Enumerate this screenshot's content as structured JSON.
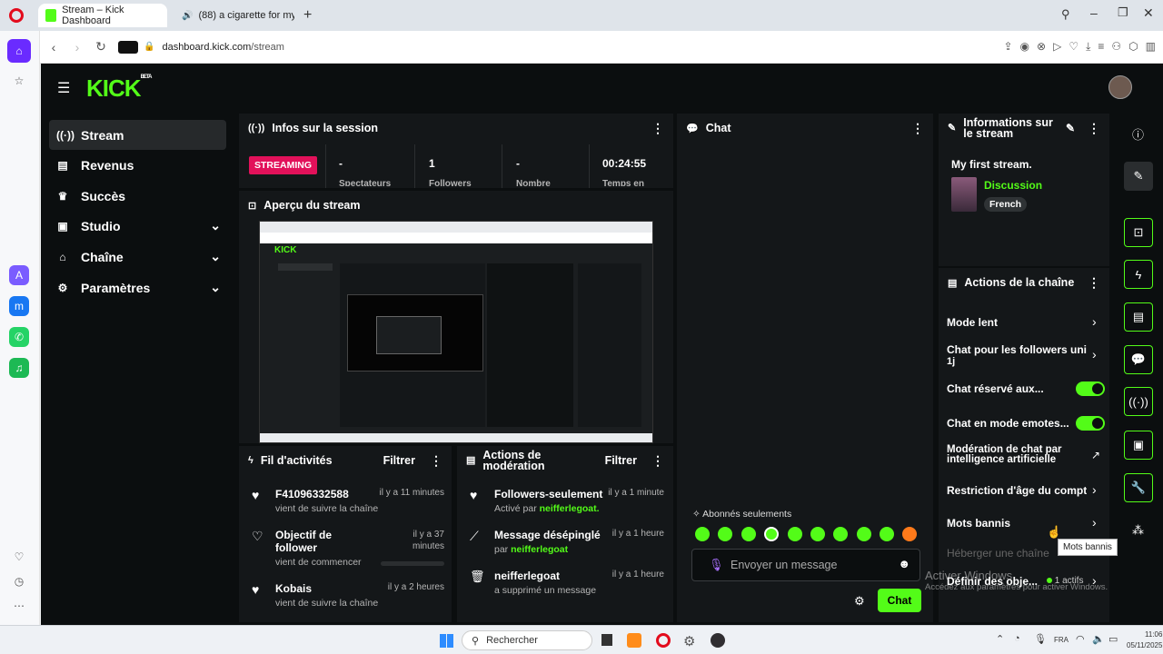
{
  "browser": {
    "tabs": [
      {
        "title": "Stream – Kick Dashboard"
      },
      {
        "title": "(88) a cigarette for my"
      }
    ],
    "url_domain": "dashboard.kick.com",
    "url_path": "/stream"
  },
  "app": {
    "logo_text": "KICK",
    "logo_badge": "BETA",
    "sidebar": [
      {
        "label": "Stream",
        "active": true
      },
      {
        "label": "Revenus"
      },
      {
        "label": "Succès"
      },
      {
        "label": "Studio",
        "expandable": true
      },
      {
        "label": "Chaîne",
        "expandable": true
      },
      {
        "label": "Paramètres",
        "expandable": true
      }
    ],
    "session": {
      "title": "Infos sur la session",
      "status": "STREAMING",
      "stats": [
        {
          "value": "-",
          "label": "Spectateurs"
        },
        {
          "value": "1",
          "label": "Followers"
        },
        {
          "value": "-",
          "label": "Nombre"
        },
        {
          "value": "00:24:55",
          "label": "Temps en"
        }
      ]
    },
    "preview": {
      "title": "Aperçu du stream"
    },
    "activity": {
      "title": "Fil d'activités",
      "filter_label": "Filtrer",
      "items": [
        {
          "name": "F41096332588",
          "time": "il y a 11 minutes",
          "desc": "vient de suivre la chaîne"
        },
        {
          "name": "Objectif de follower",
          "time": "il y a 37 minutes",
          "desc": "vient de commencer"
        },
        {
          "name": "Kobais",
          "time": "il y a 2 heures",
          "desc": "vient de suivre la chaîne"
        }
      ]
    },
    "moderation": {
      "title": "Actions de modération",
      "filter_label": "Filtrer",
      "items": [
        {
          "name": "Followers-seulement",
          "time": "il y a 1 minute",
          "desc_prefix": "Activé par",
          "actor": "neifferlegoat."
        },
        {
          "name": "Message désépinglé",
          "time": "il y a 1 heure",
          "desc_prefix": "par",
          "actor": "neifferlegoat"
        },
        {
          "name": "neifferlegoat",
          "time": "il y a 1 heure",
          "desc_prefix": "a supprimé un message",
          "actor": ""
        }
      ]
    },
    "chat": {
      "title": "Chat",
      "mode_label": "Abonnés seulements",
      "input_placeholder": "Envoyer un message",
      "send_label": "Chat"
    },
    "stream_info": {
      "title": "Informations sur le stream",
      "stream_title": "My first stream.",
      "category": "Discussion",
      "language": "French"
    },
    "channel_actions": {
      "title": "Actions de la chaîne",
      "rows": [
        {
          "label": "Mode lent",
          "type": "chevron"
        },
        {
          "label": "Chat pour les followers uni",
          "sub": "1j",
          "type": "chevron"
        },
        {
          "label": "Chat réservé aux...",
          "type": "toggle",
          "on": true
        },
        {
          "label": "Chat en mode emotes...",
          "type": "toggle",
          "on": true
        },
        {
          "label": "Modération de chat par intelligence artificielle",
          "type": "external"
        },
        {
          "label": "Restriction d'âge du compt",
          "type": "chevron"
        },
        {
          "label": "Mots bannis",
          "type": "chevron"
        },
        {
          "label": "Héberger une chaîne",
          "type": "disabled"
        },
        {
          "label": "Définir des obje...",
          "status": "1 actifs",
          "type": "chevron"
        }
      ],
      "tooltip": "Mots bannis"
    },
    "watermark": {
      "line1": "Activer Windows",
      "line2": "Accédez aux paramètres pour activer Windows."
    }
  },
  "taskbar": {
    "search_placeholder": "Rechercher",
    "lang": "FRA",
    "time": "11:06",
    "date": "05/11/2025"
  }
}
